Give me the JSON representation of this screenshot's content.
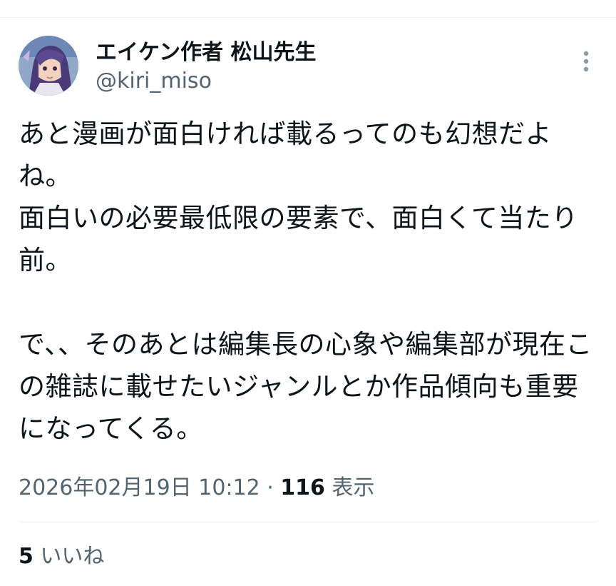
{
  "tweet": {
    "author": {
      "display_name": "エイケン作者 松山先生",
      "handle": "@kiri_miso",
      "avatar_icon": "avatar-illustration"
    },
    "more_icon": "more-vertical-icon",
    "body": "あと漫画が面白ければ載るってのも幻想だよね。\n面白いの必要最低限の要素で、面白くて当たり前。\n\nで、、そのあとは編集長の心象や編集部が現在この雑誌に載せたいジャンルとか作品傾向も重要になってくる。",
    "timestamp": "2026年02月19日 10:12",
    "separator": " · ",
    "views_count": "116",
    "views_label": " 表示",
    "likes_count": "5",
    "likes_label": " いいね"
  }
}
